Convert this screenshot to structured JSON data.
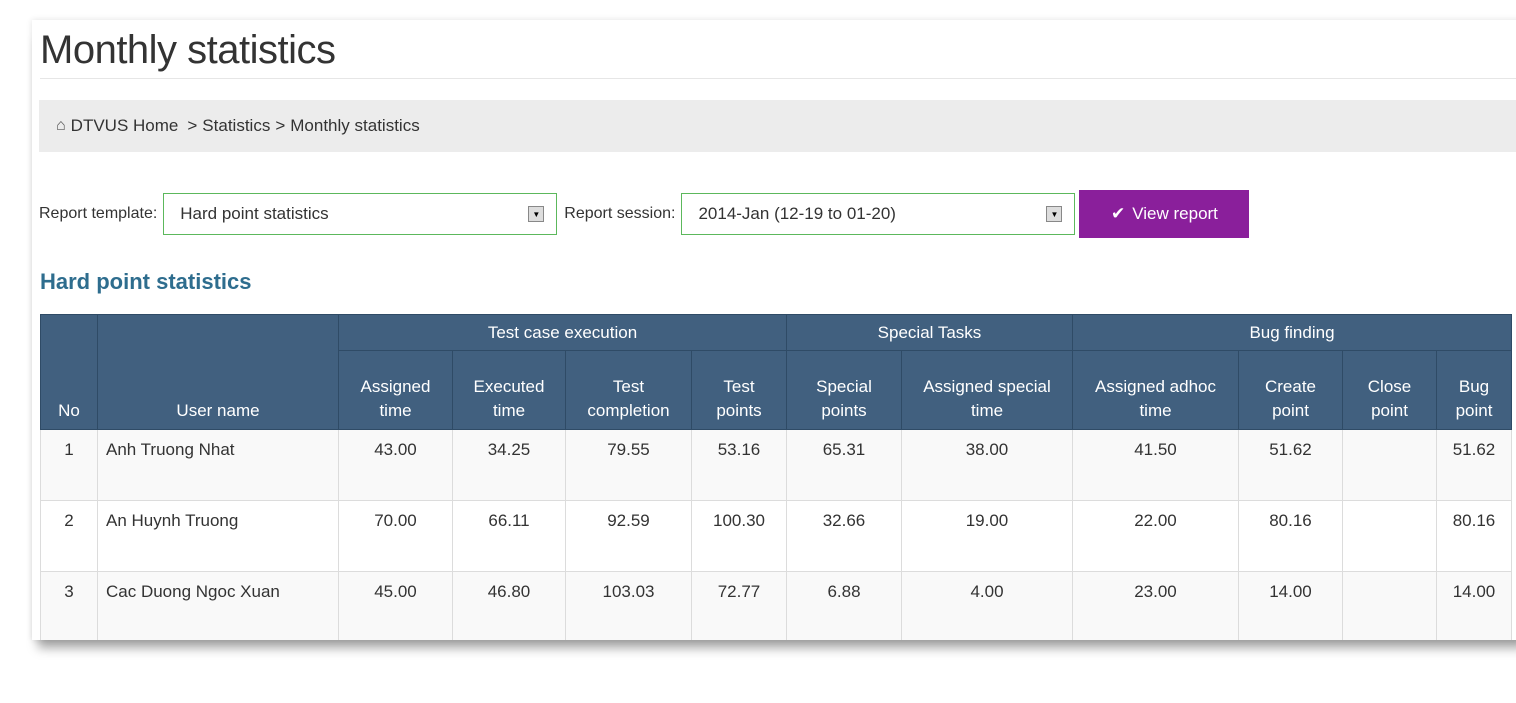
{
  "page": {
    "title": "Monthly statistics"
  },
  "breadcrumb": {
    "home": "DTVUS Home",
    "sep1": ">",
    "statistics": "Statistics",
    "sep2": ">",
    "current": "Monthly statistics"
  },
  "filters": {
    "template_label": "Report template:",
    "template_value": "Hard point statistics",
    "session_label": "Report session:",
    "session_value": "2014-Jan (12-19 to 01-20)",
    "view_button": "View report"
  },
  "section": {
    "title": "Hard point statistics"
  },
  "table": {
    "groups": {
      "test_case": "Test case execution",
      "special": "Special Tasks",
      "bug": "Bug finding"
    },
    "columns": {
      "no": "No",
      "user": "User name",
      "assigned_time": [
        "Assigned",
        "time"
      ],
      "executed_time": [
        "Executed",
        "time"
      ],
      "test_completion": [
        "Test",
        "completion"
      ],
      "test_points": [
        "Test",
        "points"
      ],
      "special_points": [
        "Special",
        "points"
      ],
      "assigned_special": [
        "Assigned special",
        "time"
      ],
      "assigned_adhoc": [
        "Assigned adhoc",
        "time"
      ],
      "create_point": [
        "Create",
        "point"
      ],
      "close_point": [
        "Close",
        "point"
      ],
      "bug_point": [
        "Bug",
        "point"
      ]
    },
    "rows": [
      {
        "no": "1",
        "user": "Anh Truong Nhat",
        "assigned_time": "43.00",
        "executed_time": "34.25",
        "test_completion": "79.55",
        "test_points": "53.16",
        "special_points": "65.31",
        "assigned_special": "38.00",
        "assigned_adhoc": "41.50",
        "create_point": "51.62",
        "close_point": "",
        "bug_point": "51.62"
      },
      {
        "no": "2",
        "user": "An Huynh Truong",
        "assigned_time": "70.00",
        "executed_time": "66.11",
        "test_completion": "92.59",
        "test_points": "100.30",
        "special_points": "32.66",
        "assigned_special": "19.00",
        "assigned_adhoc": "22.00",
        "create_point": "80.16",
        "close_point": "",
        "bug_point": "80.16"
      },
      {
        "no": "3",
        "user": "Cac Duong Ngoc Xuan",
        "assigned_time": "45.00",
        "executed_time": "46.80",
        "test_completion": "103.03",
        "test_points": "72.77",
        "special_points": "6.88",
        "assigned_special": "4.00",
        "assigned_adhoc": "23.00",
        "create_point": "14.00",
        "close_point": "",
        "bug_point": "14.00"
      }
    ]
  },
  "icons": {
    "home": "home-icon",
    "check": "check-icon",
    "dropdown": "dropdown-arrow-icon"
  },
  "colors": {
    "button": "#8a1f9b",
    "table_header": "#41607f",
    "section_title": "#2e6d8e",
    "select_border": "#5cb85c"
  }
}
